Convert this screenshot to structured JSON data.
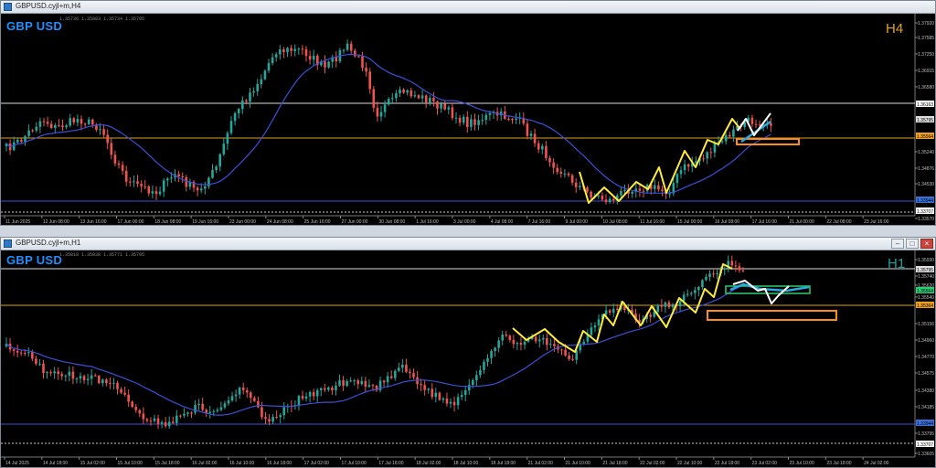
{
  "colors": {
    "bull": "#26a69a",
    "bear": "#ef5350",
    "ma": "#3b4fd9",
    "zigzag": "#ffeb3b",
    "proj_white": "#ffffff",
    "proj_blue": "#29a9e0",
    "orange": "#ff8c1a",
    "green": "#2ecc71",
    "symbol_text": "#1e90ff",
    "tf_text": "#e0a020",
    "tf_text_h1": "#1fa0a0"
  },
  "top": {
    "window_title": "GBPUSD.cyjl+m,H4",
    "symbol": "GBP USD",
    "timeframe": "H4",
    "ohlc": "1.35736 1.35883 1.35734 1.35795",
    "price_labels": [
      "1.37920",
      "1.37585",
      "1.37250",
      "1.36915",
      "1.36580",
      "1.36163",
      "1.35795",
      "1.35564",
      "1.35240",
      "1.34876",
      "1.34530",
      "1.33944",
      "1.33707",
      "1.33570"
    ],
    "time_labels": [
      "11 Jun 2025",
      "12 Jun 08:00",
      "13 Jun 16:00",
      "17 Jun 00:00",
      "18 Jun 08:00",
      "19 Jun 16:00",
      "23 Jun 00:00",
      "24 Jun 08:00",
      "25 Jun 16:00",
      "27 Jun 00:00",
      "30 Jun 08:00",
      "1 Jul 16:00",
      "3 Jul 00:00",
      "4 Jul 08:00",
      "7 Jul 16:00",
      "9 Jul 00:00",
      "10 Jul 08:00",
      "11 Jul 16:00",
      "15 Jul 00:00",
      "16 Jul 08:00",
      "17 Jul 16:00",
      "21 Jul 00:00",
      "22 Jul 08:00",
      "23 Jul 16:00"
    ]
  },
  "bottom": {
    "window_title": "GBPUSD.cyjl+m,H1",
    "symbol": "GBP USD",
    "timeframe": "H1",
    "ohlc": "1.35818 1.35838 1.35771 1.35795",
    "price_labels": [
      "1.35930",
      "1.35795",
      "1.35740",
      "1.35620",
      "1.35564",
      "1.35540",
      "1.35364",
      "1.35156",
      "1.34960",
      "1.34770",
      "1.34575",
      "1.34380",
      "1.34185",
      "1.33944",
      "1.33795",
      "1.33707",
      "1.33605"
    ],
    "time_labels": [
      "14 Jul 2025",
      "14 Jul 18:00",
      "15 Jul 02:00",
      "15 Jul 10:00",
      "15 Jul 18:00",
      "16 Jul 02:00",
      "16 Jul 10:00",
      "16 Jul 18:00",
      "17 Jul 02:00",
      "17 Jul 10:00",
      "17 Jul 18:00",
      "18 Jul 02:00",
      "18 Jul 10:00",
      "18 Jul 18:00",
      "21 Jul 02:00",
      "21 Jul 10:00",
      "21 Jul 18:00",
      "22 Jul 02:00",
      "22 Jul 10:00",
      "22 Jul 18:00",
      "23 Jul 02:00",
      "23 Jul 10:00",
      "23 Jul 18:00",
      "24 Jul 02:00"
    ]
  }
}
